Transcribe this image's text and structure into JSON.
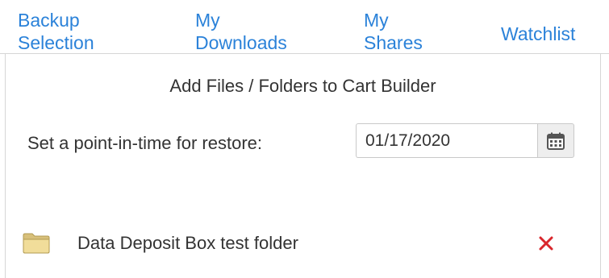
{
  "tabs": {
    "backup_selection": "Backup\nSelection",
    "my_downloads": "My\nDownloads",
    "my_shares": "My\nShares",
    "watchlist": "Watchlist"
  },
  "panel": {
    "title": "Add Files / Folders to Cart Builder",
    "point_in_time_label": "Set a point-in-time for restore:",
    "date_value": "01/17/2020",
    "calendar_icon": "calendar-icon"
  },
  "items": [
    {
      "name": "Data Deposit Box test folder",
      "icon": "folder-icon",
      "action_icon": "remove-icon"
    }
  ],
  "colors": {
    "link": "#2b82d9",
    "text": "#333333",
    "remove": "#d9262c",
    "border": "#d6d6d6"
  }
}
